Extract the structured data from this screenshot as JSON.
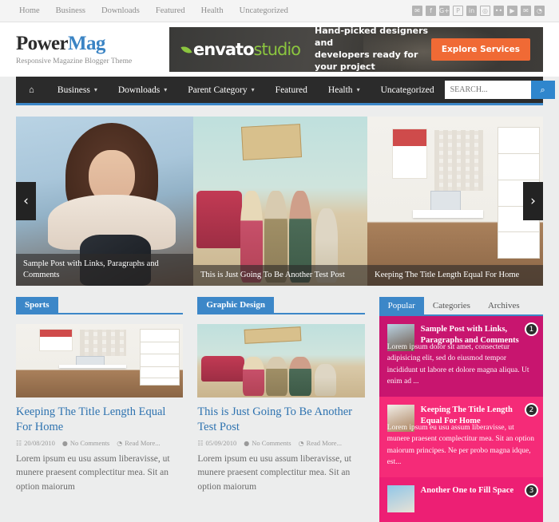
{
  "topnav": {
    "items": [
      {
        "label": "Home"
      },
      {
        "label": "Business"
      },
      {
        "label": "Downloads"
      },
      {
        "label": "Featured"
      },
      {
        "label": "Health"
      },
      {
        "label": "Uncategorized"
      }
    ],
    "social": [
      {
        "name": "twitter-icon",
        "glyph": "✉"
      },
      {
        "name": "facebook-icon",
        "glyph": "f"
      },
      {
        "name": "google-plus-icon",
        "glyph": "G+"
      },
      {
        "name": "pinterest-icon",
        "glyph": "P"
      },
      {
        "name": "linkedin-icon",
        "glyph": "in"
      },
      {
        "name": "instagram-icon",
        "glyph": "◎"
      },
      {
        "name": "flickr-icon",
        "glyph": "••"
      },
      {
        "name": "youtube-icon",
        "glyph": "▶"
      },
      {
        "name": "email-icon",
        "glyph": "✉"
      },
      {
        "name": "rss-icon",
        "glyph": "◔"
      }
    ]
  },
  "header": {
    "logo_part1": "Power",
    "logo_part2": "Mag",
    "tagline": "Responsive Magazine Blogger Theme",
    "ad": {
      "brand_part1": "envato",
      "brand_part2": "studio",
      "copy_line1": "Hand-picked designers and",
      "copy_line2": "developers ready for your project",
      "button": "Explore Services",
      "button_color": "#f06a35",
      "accent_color": "#8bc53f"
    }
  },
  "mainnav": {
    "home_icon": "⌂",
    "items": [
      {
        "label": "Business",
        "dropdown": true
      },
      {
        "label": "Downloads",
        "dropdown": true
      },
      {
        "label": "Parent Category",
        "dropdown": true
      },
      {
        "label": "Featured",
        "dropdown": false
      },
      {
        "label": "Health",
        "dropdown": true
      },
      {
        "label": "Uncategorized",
        "dropdown": false
      }
    ],
    "chevron": "▾",
    "search_placeholder": "SEARCH...",
    "search_value": "",
    "search_icon": "⌕",
    "accent_color": "#3c87c8",
    "bar_color": "#2b2b2b"
  },
  "slider": {
    "prev_icon": "‹",
    "next_icon": "›",
    "slides": [
      {
        "caption": "Sample Post with Links, Paragraphs and Comments"
      },
      {
        "caption": "This is Just Going To Be Another Test Post"
      },
      {
        "caption": "Keeping The Title Length Equal For Home"
      }
    ]
  },
  "columns": [
    {
      "section": "Sports",
      "post": {
        "title": "Keeping The Title Length Equal For Home",
        "date": "20/08/2010",
        "comments": "No Comments",
        "readmore": "Read More...",
        "excerpt": "Lorem ipsum eu usu assum liberavisse, ut munere praesent complectitur mea. Sit an option maiorum"
      }
    },
    {
      "section": "Graphic Design",
      "post": {
        "title": "This is Just Going To Be Another Test Post",
        "date": "05/09/2010",
        "comments": "No Comments",
        "readmore": "Read More...",
        "excerpt": "Lorem ipsum eu usu assum liberavisse, ut munere praesent complectitur mea. Sit an option maiorum"
      }
    }
  ],
  "meta_icons": {
    "calendar": "☷",
    "comment": "●",
    "clock": "◔"
  },
  "sidebar": {
    "tabs": [
      {
        "label": "Popular",
        "active": true
      },
      {
        "label": "Categories",
        "active": false
      },
      {
        "label": "Archives",
        "active": false
      }
    ],
    "popular": [
      {
        "rank": "1",
        "title": "Sample Post with Links, Paragraphs and Comments",
        "excerpt": "Lorem ipsum dolor sit amet, consectetur adipisicing elit, sed do eiusmod tempor incididunt ut labore et dolore magna aliqua. Ut enim ad ...",
        "color": "#c8156f"
      },
      {
        "rank": "2",
        "title": "Keeping The Title Length Equal For Home",
        "excerpt": "Lorem ipsum eu usu assum liberavisse, ut munere praesent complectitur mea. Sit an option maiorum principes. Ne per probo magna idque, est...",
        "color": "#f52b78"
      },
      {
        "rank": "3",
        "title": "Another One to Fill Space",
        "excerpt": "",
        "color": "#ed1f74"
      }
    ]
  }
}
